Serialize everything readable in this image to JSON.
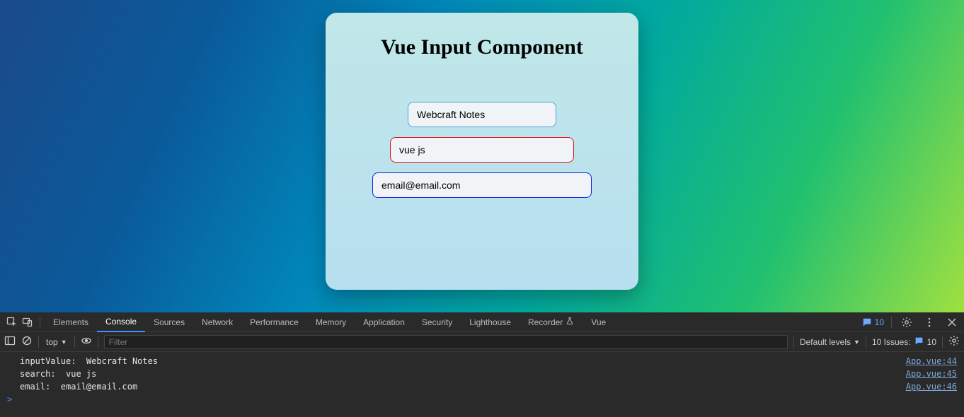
{
  "card": {
    "title": "Vue Input Component",
    "inputs": {
      "default": "Webcraft Notes",
      "error": "vue js",
      "success": "email@email.com"
    }
  },
  "devtools": {
    "tabs": [
      "Elements",
      "Console",
      "Sources",
      "Network",
      "Performance",
      "Memory",
      "Application",
      "Security",
      "Lighthouse",
      "Recorder",
      "Vue"
    ],
    "active_tab": "Console",
    "tab_badge": "10",
    "filter_placeholder": "Filter",
    "context": "top",
    "levels_label": "Default levels",
    "issues": {
      "label": "10 Issues:",
      "count": "10"
    },
    "logs": [
      {
        "msg": "inputValue:  Webcraft Notes",
        "src": "App.vue:44"
      },
      {
        "msg": "search:  vue js",
        "src": "App.vue:45"
      },
      {
        "msg": "email:  email@email.com",
        "src": "App.vue:46"
      }
    ],
    "prompt": ">"
  }
}
